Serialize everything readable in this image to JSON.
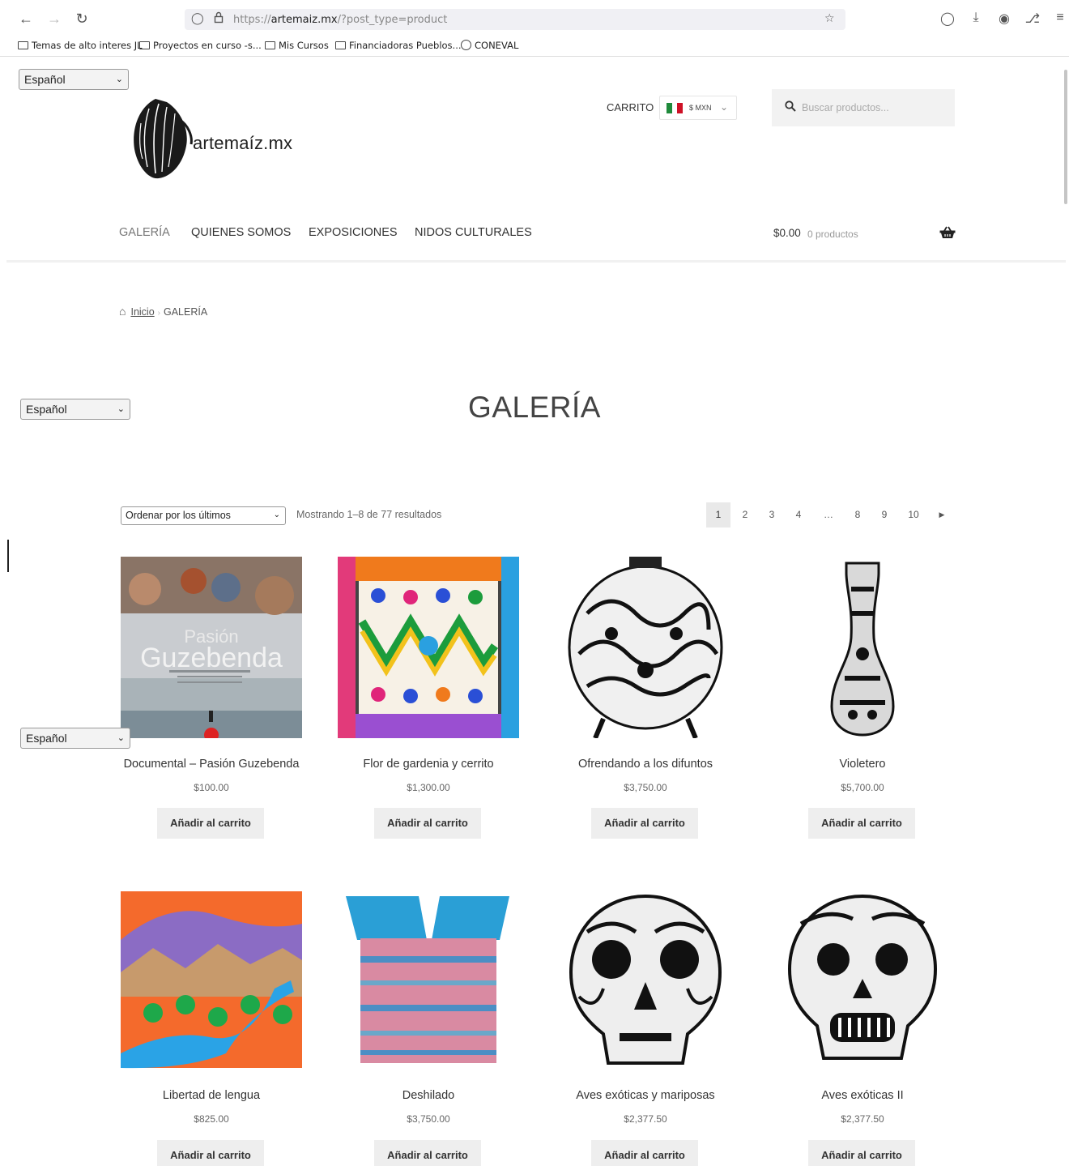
{
  "browser": {
    "url_prefix": "https://",
    "url_domain": "artemaiz.mx",
    "url_path": "/?post_type=product",
    "bookmarks": [
      "Temas de alto interes JL",
      "Proyectos en curso -s...",
      "Mis Cursos",
      "Financiadoras Pueblos...",
      "CONEVAL"
    ]
  },
  "language_select": {
    "value": "Español"
  },
  "header": {
    "logo_text": "artemaíz.mx",
    "cart_label": "CARRITO",
    "currency": "$ MXN",
    "search_placeholder": "Buscar productos...",
    "mini_cart_amount": "$0.00",
    "mini_cart_count": "0 productos"
  },
  "nav": {
    "items": [
      "GALERÍA",
      "QUIENES SOMOS",
      "EXPOSICIONES",
      "NIDOS CULTURALES"
    ]
  },
  "breadcrumb": {
    "home": "Inicio",
    "current": "GALERÍA"
  },
  "page_title": "GALERÍA",
  "toolbar": {
    "orderby": "Ordenar por los últimos",
    "result_count": "Mostrando 1–8 de 77 resultados",
    "pages": [
      "1",
      "2",
      "3",
      "4",
      "…",
      "8",
      "9",
      "10"
    ],
    "current_page": "1"
  },
  "products": [
    {
      "title": "Documental – Pasión Guzebenda",
      "price": "$100.00",
      "button": "Añadir al carrito",
      "poster_line1": "Pasión",
      "poster_line2": "Guzebenda"
    },
    {
      "title": "Flor de gardenia y cerrito",
      "price": "$1,300.00",
      "button": "Añadir al carrito"
    },
    {
      "title": "Ofrendando a los difuntos",
      "price": "$3,750.00",
      "button": "Añadir al carrito"
    },
    {
      "title": "Violetero",
      "price": "$5,700.00",
      "button": "Añadir al carrito"
    },
    {
      "title": "Libertad de lengua",
      "price": "$825.00",
      "button": "Añadir al carrito"
    },
    {
      "title": "Deshilado",
      "price": "$3,750.00",
      "button": "Añadir al carrito"
    },
    {
      "title": "Aves exóticas y mariposas",
      "price": "$2,377.50",
      "button": "Añadir al carrito"
    },
    {
      "title": "Aves exóticas II",
      "price": "$2,377.50",
      "button": "Añadir al carrito"
    }
  ],
  "colors": {
    "accent": "#333333",
    "button_bg": "#eeeeee",
    "flag_green": "#1f8a3b",
    "flag_red": "#ce1126"
  }
}
